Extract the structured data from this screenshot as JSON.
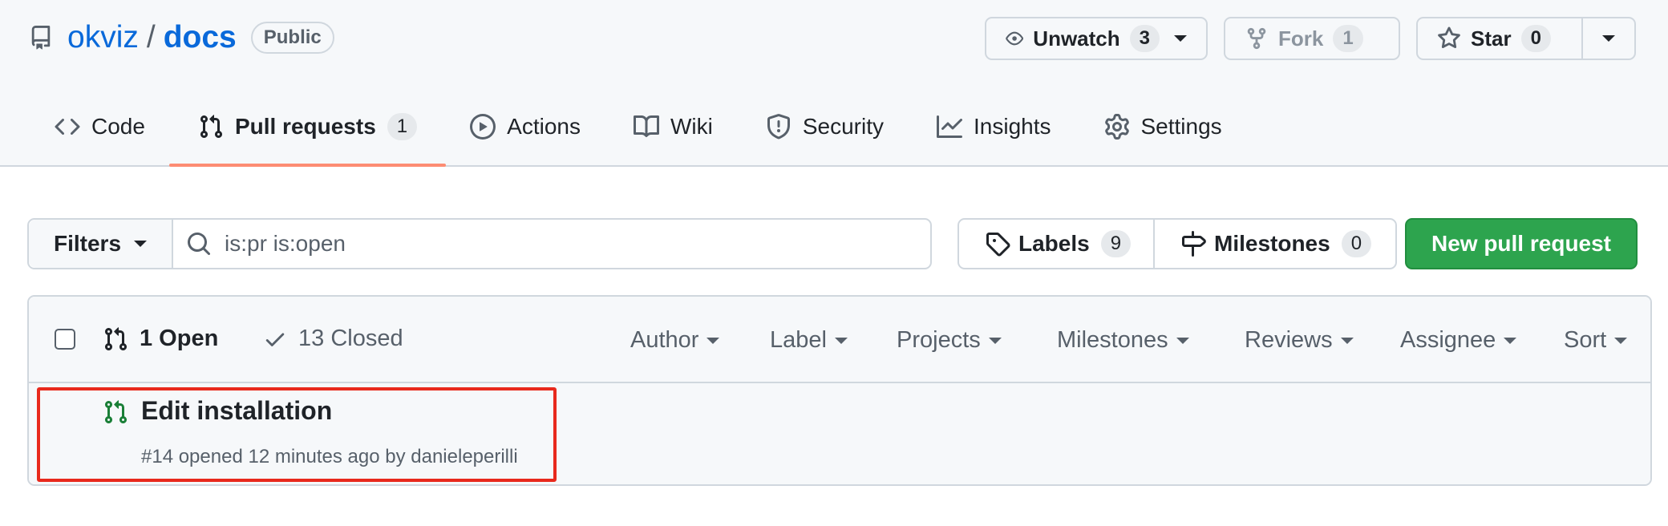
{
  "repo": {
    "owner": "okviz",
    "separator": "/",
    "name": "docs",
    "visibility": "Public"
  },
  "actions": {
    "unwatch_label": "Unwatch",
    "unwatch_count": "3",
    "fork_label": "Fork",
    "fork_count": "1",
    "star_label": "Star",
    "star_count": "0"
  },
  "nav": {
    "tabs": [
      {
        "label": "Code",
        "icon": "code-icon"
      },
      {
        "label": "Pull requests",
        "icon": "git-pull-request-icon",
        "count": "1",
        "active": true
      },
      {
        "label": "Actions",
        "icon": "play-icon"
      },
      {
        "label": "Wiki",
        "icon": "book-icon"
      },
      {
        "label": "Security",
        "icon": "shield-icon"
      },
      {
        "label": "Insights",
        "icon": "graph-icon"
      },
      {
        "label": "Settings",
        "icon": "gear-icon"
      }
    ]
  },
  "subnav": {
    "filters_label": "Filters",
    "search_value": "is:pr is:open",
    "labels_label": "Labels",
    "labels_count": "9",
    "milestones_label": "Milestones",
    "milestones_count": "0",
    "new_pr_label": "New pull request"
  },
  "list": {
    "open_label": "1 Open",
    "closed_label": "13 Closed",
    "filters": [
      "Author",
      "Label",
      "Projects",
      "Milestones",
      "Reviews",
      "Assignee",
      "Sort"
    ],
    "items": [
      {
        "title": "Edit installation",
        "meta": "#14 opened 12 minutes ago by danieleperilli"
      }
    ]
  },
  "colors": {
    "link": "#0969da",
    "primary_button": "#2da44e",
    "active_tab_underline": "#fd8c73",
    "open_icon": "#1a7f37",
    "highlight_box": "#e8291c"
  }
}
